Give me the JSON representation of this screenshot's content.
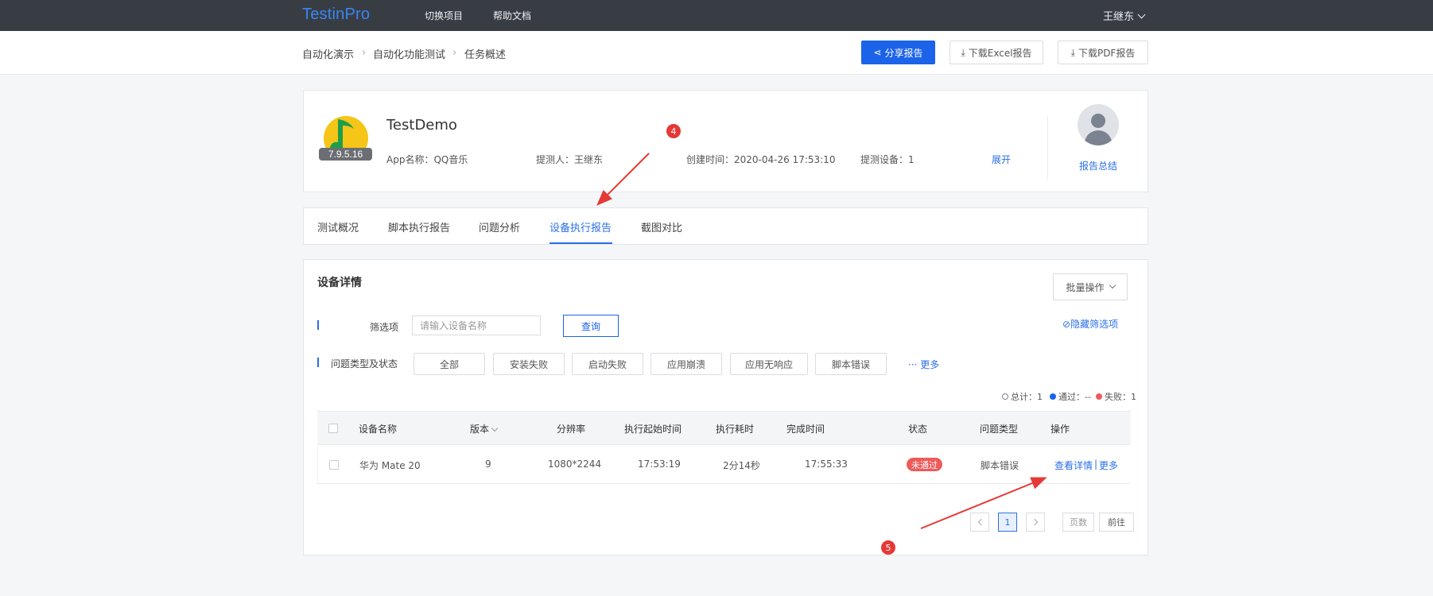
{
  "topbar": {
    "logo": "TestinPro",
    "nav": [
      "切换项目",
      "帮助文档"
    ],
    "user": "王继东"
  },
  "breadcrumb": [
    "自动化演示",
    "自动化功能测试",
    "任务概述"
  ],
  "actions": {
    "share": "分享报告",
    "excel": "下载Excel报告",
    "pdf": "下载PDF报告"
  },
  "summary": {
    "app_title": "TestDemo",
    "version": "7.9.5.16",
    "app_name": "App名称：QQ音乐",
    "submitter": "提测人：王继东",
    "created": "创建时间：2020-04-26 17:53:10",
    "devices": "提测设备：1",
    "expand": "展开",
    "report_summary": "报告总结"
  },
  "tabs": [
    {
      "label": "测试概况"
    },
    {
      "label": "脚本执行报告"
    },
    {
      "label": "问题分析"
    },
    {
      "label": "设备执行报告",
      "active": true
    },
    {
      "label": "截图对比"
    }
  ],
  "devices_panel": {
    "title": "设备详情",
    "batch": "批量操作",
    "filter_label": "筛选项",
    "search_placeholder": "请输入设备名称",
    "query": "查询",
    "hide_filter": "隐藏筛选项",
    "status_label": "问题类型及状态",
    "chips": [
      "全部",
      "安装失败",
      "启动失败",
      "应用崩溃",
      "应用无响应",
      "脚本错误"
    ],
    "more": "··· 更多",
    "stats": {
      "total": "总计：1",
      "pass": "通过：--",
      "fail": "失败：1"
    }
  },
  "table": {
    "headers": [
      "设备名称",
      "版本",
      "分辨率",
      "执行起始时间",
      "执行耗时",
      "完成时间",
      "状态",
      "问题类型",
      "操作"
    ],
    "rows": [
      {
        "device": "华为 Mate 20",
        "version": "9",
        "resolution": "1080*2244",
        "start": "17:53:19",
        "duration": "2分14秒",
        "end": "17:55:33",
        "status": "未通过",
        "issue": "脚本错误",
        "action_detail": "查看详情",
        "action_more": "更多"
      }
    ]
  },
  "pagination": {
    "current": "1",
    "pages_placeholder": "页数",
    "go": "前往"
  },
  "annotations": {
    "a": "4",
    "b": "5"
  },
  "colors": {
    "primary": "#1b63e8",
    "link": "#2b6fe6",
    "danger": "#ee5a5a",
    "topbar": "#383d44",
    "marker": "#e53935"
  }
}
